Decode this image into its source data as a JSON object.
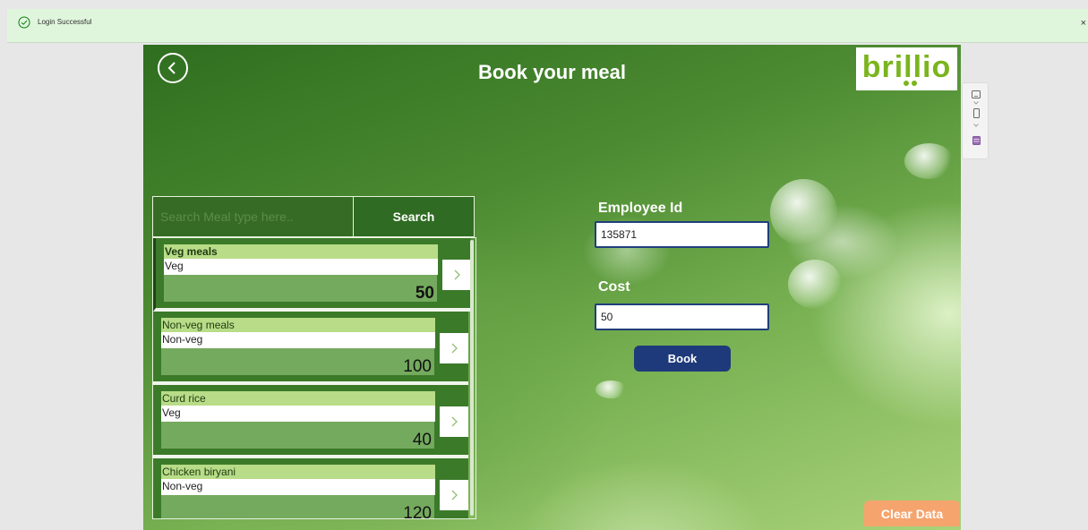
{
  "notification": {
    "message": "Login Successful",
    "close_glyph": "×",
    "icon": "check-circle-icon"
  },
  "app": {
    "title": "Book your meal",
    "logo_text": "brillio",
    "back_icon": "chevron-left-circle-icon"
  },
  "search": {
    "placeholder": "Search Meal type here..",
    "value": "",
    "button_label": "Search"
  },
  "meals": [
    {
      "name": "Veg meals",
      "type": "Veg",
      "price": "50",
      "selected": true
    },
    {
      "name": "Non-veg meals",
      "type": "Non-veg",
      "price": "100",
      "selected": false
    },
    {
      "name": "Curd rice",
      "type": "Veg",
      "price": "40",
      "selected": false
    },
    {
      "name": "Chicken biryani",
      "type": "Non-veg",
      "price": "120",
      "selected": false
    }
  ],
  "form": {
    "employee_label": "Employee Id",
    "employee_value": "135871",
    "cost_label": "Cost",
    "cost_value": "50",
    "book_label": "Book"
  },
  "clear_label": "Clear Data",
  "colors": {
    "accent_green": "#7ab51d",
    "book_blue": "#1f3a7a",
    "clear_orange": "#f5a46e"
  }
}
